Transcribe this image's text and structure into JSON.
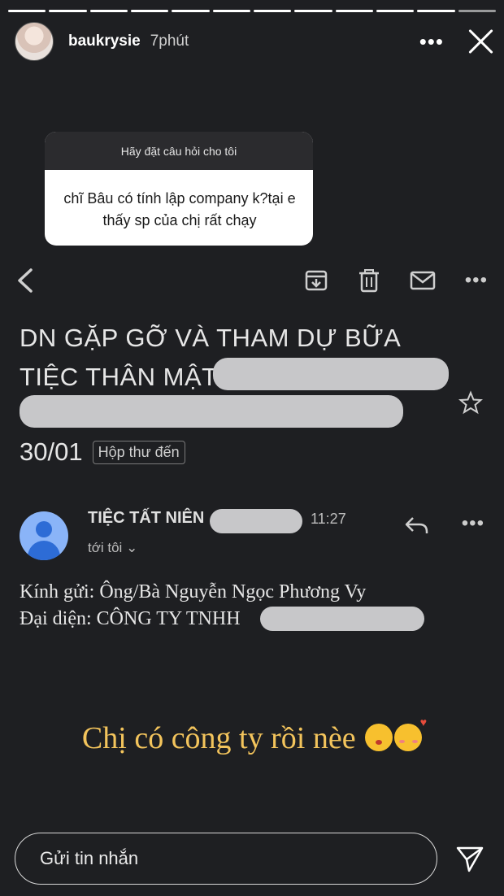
{
  "story": {
    "segments": 12,
    "username": "baukrysie",
    "time": "7phút"
  },
  "question": {
    "header": "Hãy đặt câu hỏi cho tôi",
    "text": "chĩ Bâu có tính lập company k?tại e thấy sp của chị rất chạy"
  },
  "email": {
    "subject_line1": "DN GẶP GỠ VÀ THAM DỰ BỮA",
    "subject_line2": "TIỆC THÂN MẬT",
    "date": "30/01",
    "inbox_label": "Hộp thư đến",
    "sender": "TIỆC TẤT NIÊN",
    "sent_time": "11:27",
    "recipient": "tới tôi",
    "body_line1": "Kính gửi: Ông/Bà Nguyễn Ngọc Phương Vy",
    "body_line2": "Đại diện: CÔNG TY TNHH"
  },
  "caption": "Chị có công ty rồi nèe",
  "message_input": {
    "placeholder": "Gửi tin nhắn"
  },
  "icons": {
    "more": "more-icon",
    "close": "close-icon",
    "back": "back-arrow-icon",
    "archive": "archive-icon",
    "delete": "trash-icon",
    "mail": "mail-icon",
    "star": "star-icon",
    "reply": "reply-icon",
    "send": "send-icon"
  },
  "colors": {
    "background": "#1e1f22",
    "caption": "#f3c45c",
    "avatar": "#8ab4f8"
  }
}
